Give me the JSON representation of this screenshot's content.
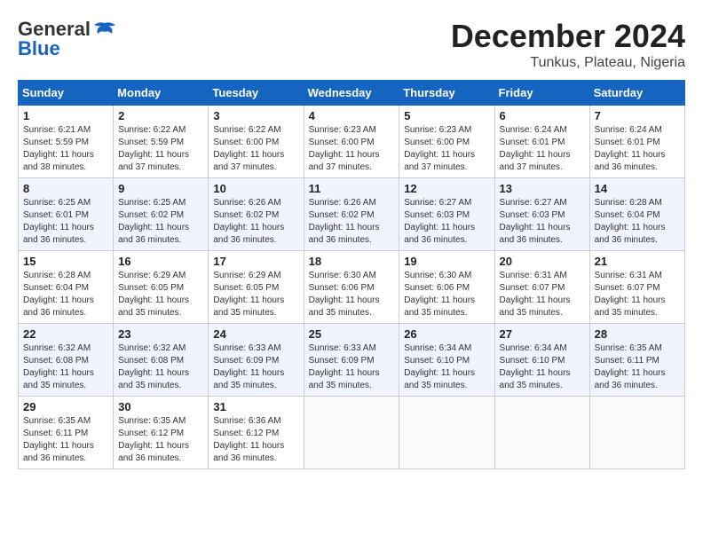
{
  "header": {
    "logo_general": "General",
    "logo_blue": "Blue",
    "month_title": "December 2024",
    "location": "Tunkus, Plateau, Nigeria"
  },
  "calendar": {
    "days_of_week": [
      "Sunday",
      "Monday",
      "Tuesday",
      "Wednesday",
      "Thursday",
      "Friday",
      "Saturday"
    ],
    "weeks": [
      [
        null,
        {
          "day": "2",
          "sunrise": "6:22 AM",
          "sunset": "5:59 PM",
          "daylight": "11 hours and 37 minutes."
        },
        {
          "day": "3",
          "sunrise": "6:22 AM",
          "sunset": "6:00 PM",
          "daylight": "11 hours and 37 minutes."
        },
        {
          "day": "4",
          "sunrise": "6:23 AM",
          "sunset": "6:00 PM",
          "daylight": "11 hours and 37 minutes."
        },
        {
          "day": "5",
          "sunrise": "6:23 AM",
          "sunset": "6:00 PM",
          "daylight": "11 hours and 37 minutes."
        },
        {
          "day": "6",
          "sunrise": "6:24 AM",
          "sunset": "6:01 PM",
          "daylight": "11 hours and 37 minutes."
        },
        {
          "day": "7",
          "sunrise": "6:24 AM",
          "sunset": "6:01 PM",
          "daylight": "11 hours and 36 minutes."
        }
      ],
      [
        {
          "day": "1",
          "sunrise": "6:21 AM",
          "sunset": "5:59 PM",
          "daylight": "11 hours and 38 minutes."
        },
        {
          "day": "9",
          "sunrise": "6:25 AM",
          "sunset": "6:02 PM",
          "daylight": "11 hours and 36 minutes."
        },
        {
          "day": "10",
          "sunrise": "6:26 AM",
          "sunset": "6:02 PM",
          "daylight": "11 hours and 36 minutes."
        },
        {
          "day": "11",
          "sunrise": "6:26 AM",
          "sunset": "6:02 PM",
          "daylight": "11 hours and 36 minutes."
        },
        {
          "day": "12",
          "sunrise": "6:27 AM",
          "sunset": "6:03 PM",
          "daylight": "11 hours and 36 minutes."
        },
        {
          "day": "13",
          "sunrise": "6:27 AM",
          "sunset": "6:03 PM",
          "daylight": "11 hours and 36 minutes."
        },
        {
          "day": "14",
          "sunrise": "6:28 AM",
          "sunset": "6:04 PM",
          "daylight": "11 hours and 36 minutes."
        }
      ],
      [
        {
          "day": "8",
          "sunrise": "6:25 AM",
          "sunset": "6:01 PM",
          "daylight": "11 hours and 36 minutes."
        },
        {
          "day": "16",
          "sunrise": "6:29 AM",
          "sunset": "6:05 PM",
          "daylight": "11 hours and 35 minutes."
        },
        {
          "day": "17",
          "sunrise": "6:29 AM",
          "sunset": "6:05 PM",
          "daylight": "11 hours and 35 minutes."
        },
        {
          "day": "18",
          "sunrise": "6:30 AM",
          "sunset": "6:06 PM",
          "daylight": "11 hours and 35 minutes."
        },
        {
          "day": "19",
          "sunrise": "6:30 AM",
          "sunset": "6:06 PM",
          "daylight": "11 hours and 35 minutes."
        },
        {
          "day": "20",
          "sunrise": "6:31 AM",
          "sunset": "6:07 PM",
          "daylight": "11 hours and 35 minutes."
        },
        {
          "day": "21",
          "sunrise": "6:31 AM",
          "sunset": "6:07 PM",
          "daylight": "11 hours and 35 minutes."
        }
      ],
      [
        {
          "day": "15",
          "sunrise": "6:28 AM",
          "sunset": "6:04 PM",
          "daylight": "11 hours and 36 minutes."
        },
        {
          "day": "23",
          "sunrise": "6:32 AM",
          "sunset": "6:08 PM",
          "daylight": "11 hours and 35 minutes."
        },
        {
          "day": "24",
          "sunrise": "6:33 AM",
          "sunset": "6:09 PM",
          "daylight": "11 hours and 35 minutes."
        },
        {
          "day": "25",
          "sunrise": "6:33 AM",
          "sunset": "6:09 PM",
          "daylight": "11 hours and 35 minutes."
        },
        {
          "day": "26",
          "sunrise": "6:34 AM",
          "sunset": "6:10 PM",
          "daylight": "11 hours and 35 minutes."
        },
        {
          "day": "27",
          "sunrise": "6:34 AM",
          "sunset": "6:10 PM",
          "daylight": "11 hours and 35 minutes."
        },
        {
          "day": "28",
          "sunrise": "6:35 AM",
          "sunset": "6:11 PM",
          "daylight": "11 hours and 36 minutes."
        }
      ],
      [
        {
          "day": "22",
          "sunrise": "6:32 AM",
          "sunset": "6:08 PM",
          "daylight": "11 hours and 35 minutes."
        },
        {
          "day": "30",
          "sunrise": "6:35 AM",
          "sunset": "6:12 PM",
          "daylight": "11 hours and 36 minutes."
        },
        {
          "day": "31",
          "sunrise": "6:36 AM",
          "sunset": "6:12 PM",
          "daylight": "11 hours and 36 minutes."
        },
        null,
        null,
        null,
        null
      ],
      [
        {
          "day": "29",
          "sunrise": "6:35 AM",
          "sunset": "6:11 PM",
          "daylight": "11 hours and 36 minutes."
        },
        null,
        null,
        null,
        null,
        null,
        null
      ]
    ]
  }
}
